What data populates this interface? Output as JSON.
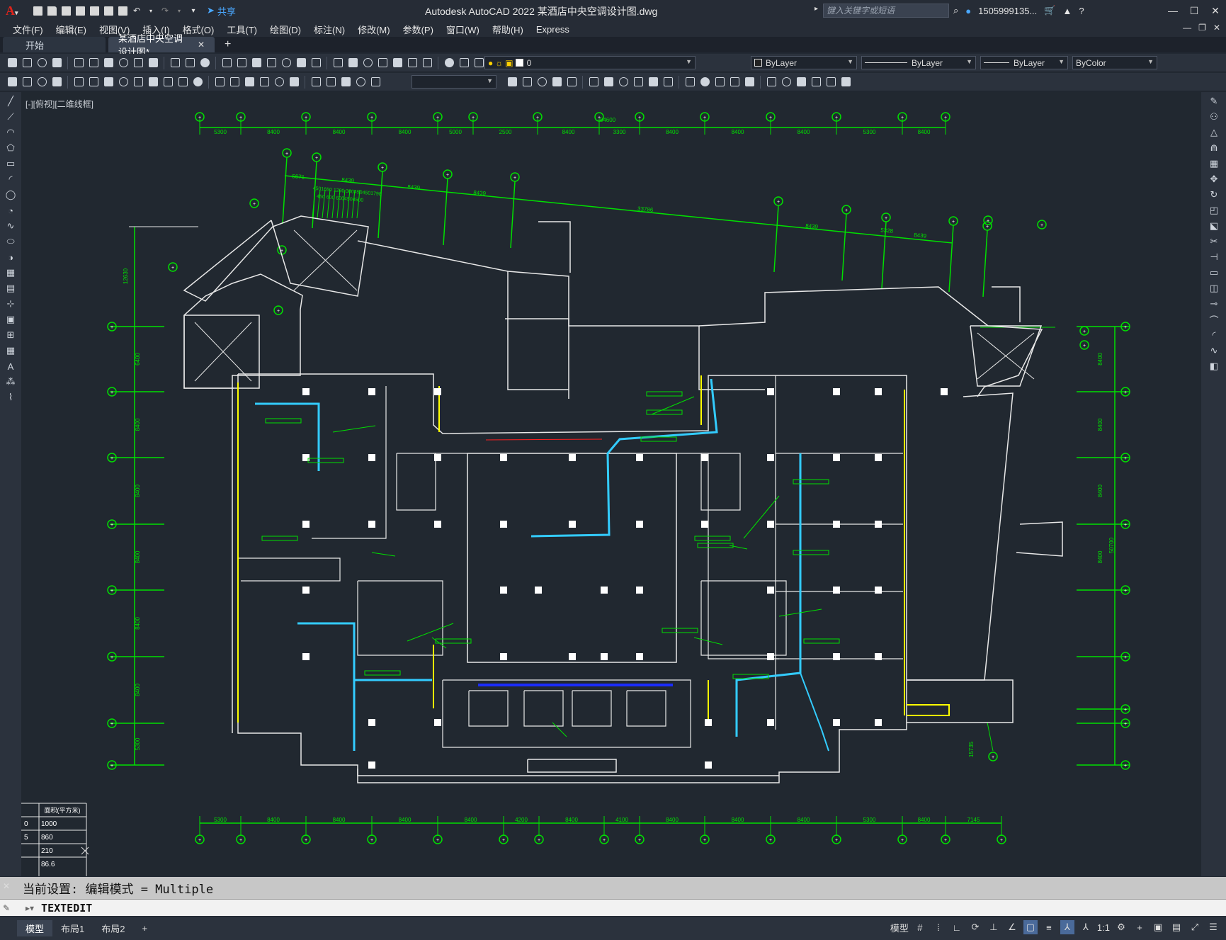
{
  "titlebar": {
    "title": "Autodesk AutoCAD 2022    某酒店中央空调设计图.dwg",
    "share_label": "共享",
    "search_placeholder": "键入关键字或短语",
    "user": "1505999135...",
    "icons": [
      "new-icon",
      "open-icon",
      "save-icon",
      "saveas-icon",
      "open-web-icon",
      "save-web-icon",
      "plot-icon",
      "undo-icon",
      "redo-icon"
    ]
  },
  "menu": [
    "文件(F)",
    "编辑(E)",
    "视图(V)",
    "插入(I)",
    "格式(O)",
    "工具(T)",
    "绘图(D)",
    "标注(N)",
    "修改(M)",
    "参数(P)",
    "窗口(W)",
    "帮助(H)",
    "Express"
  ],
  "tabs": {
    "start": "开始",
    "active": "某酒店中央空调设计图*"
  },
  "toolbar": {
    "layer_value": "0",
    "color_value": "ByLayer",
    "linetype_value": "ByLayer",
    "lineweight_value": "ByLayer",
    "plotstyle_value": "ByColor"
  },
  "viewport": {
    "label": "[-][俯视][二维线框]"
  },
  "drawing": {
    "top_dims": [
      "5300",
      "8400",
      "8400",
      "8400",
      "5000",
      "2500",
      "8400",
      "3300",
      "8400",
      "8400",
      "8400",
      "5300",
      "8400"
    ],
    "top_total": "84600",
    "bottom_dims": [
      "5300",
      "8400",
      "8400",
      "8400",
      "8400",
      "4200",
      "8400",
      "4100",
      "8400",
      "8400",
      "8400",
      "5300",
      "8400",
      "7145"
    ],
    "diag_dims": [
      "5671",
      "8439",
      "8439",
      "8439",
      "33786",
      "8439",
      "5328",
      "8439"
    ],
    "left_dims": [
      "6400",
      "8400",
      "8400",
      "8400",
      "8400",
      "8400",
      "5300"
    ],
    "left_top": "12630",
    "right_dims": [
      "8400",
      "8400",
      "8400",
      "8400"
    ],
    "right_total": "50700",
    "right_extra": "15735",
    "table_header": "面积(平方米)",
    "table_values": [
      "1000",
      "860",
      "210",
      "86.6"
    ],
    "table_left": [
      "0",
      "5"
    ]
  },
  "command": {
    "history": "当前设置: 编辑模式 = Multiple",
    "input": "TEXTEDIT"
  },
  "status": {
    "layout_tabs": [
      "模型",
      "布局1",
      "布局2"
    ],
    "model_label": "模型",
    "scale": "1:1"
  },
  "colors": {
    "bg": "#212830",
    "grid": "#00e000",
    "wall": "#e8e8e8",
    "accent_yellow": "#ffff00",
    "duct_cyan": "#33ccff",
    "duct_blue": "#1a2cff"
  }
}
